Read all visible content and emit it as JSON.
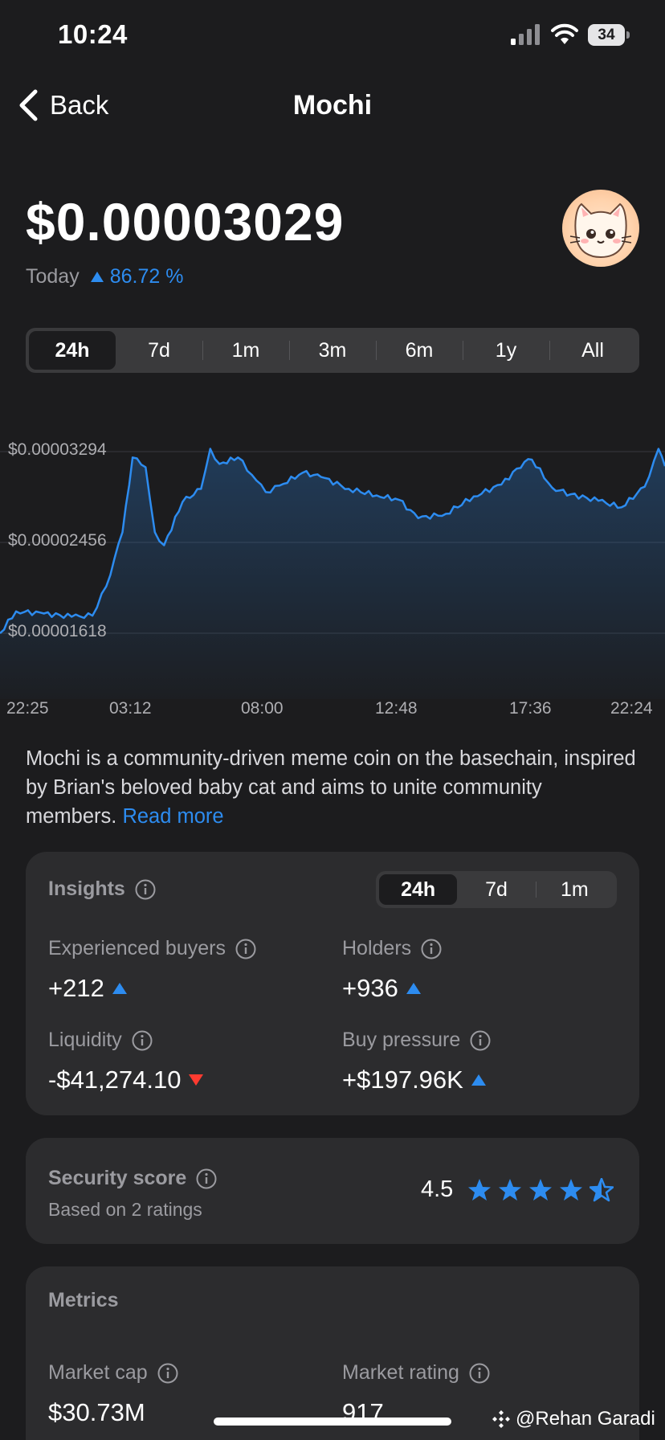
{
  "status": {
    "time": "10:24",
    "battery": "34"
  },
  "nav": {
    "back_label": "Back",
    "title": "Mochi"
  },
  "price": {
    "value": "$0.00003029",
    "period": "Today",
    "change": "86.72 %"
  },
  "ranges": [
    "24h",
    "7d",
    "1m",
    "3m",
    "6m",
    "1y",
    "All"
  ],
  "chart_data": {
    "type": "area",
    "color": "#2d8cf0",
    "y_ticks": [
      "$0.00003294",
      "$0.00002456",
      "$0.00001618"
    ],
    "x_ticks": [
      "22:25",
      "03:12",
      "08:00",
      "12:48",
      "17:36",
      "22:24"
    ],
    "ylim": [
      1.618e-05,
      3.294e-05
    ],
    "points": [
      [
        "22:25",
        1.618e-05
      ],
      [
        "23:00",
        1.82e-05
      ],
      [
        "00:00",
        1.8e-05
      ],
      [
        "01:00",
        1.77e-05
      ],
      [
        "01:45",
        1.78e-05
      ],
      [
        "02:15",
        2.05e-05
      ],
      [
        "02:50",
        2.55e-05
      ],
      [
        "03:12",
        3.24e-05
      ],
      [
        "03:40",
        3.15e-05
      ],
      [
        "04:00",
        2.55e-05
      ],
      [
        "04:20",
        2.43e-05
      ],
      [
        "05:00",
        2.83e-05
      ],
      [
        "05:40",
        2.95e-05
      ],
      [
        "06:00",
        3.32e-05
      ],
      [
        "06:20",
        3.18e-05
      ],
      [
        "07:00",
        3.24e-05
      ],
      [
        "07:30",
        3.08e-05
      ],
      [
        "08:00",
        2.92e-05
      ],
      [
        "08:30",
        2.98e-05
      ],
      [
        "09:20",
        3.1e-05
      ],
      [
        "10:00",
        3.06e-05
      ],
      [
        "11:00",
        2.95e-05
      ],
      [
        "12:00",
        2.89e-05
      ],
      [
        "12:48",
        2.85e-05
      ],
      [
        "13:30",
        2.68e-05
      ],
      [
        "14:30",
        2.72e-05
      ],
      [
        "15:30",
        2.88e-05
      ],
      [
        "16:30",
        2.99e-05
      ],
      [
        "17:20",
        3.2e-05
      ],
      [
        "17:36",
        3.22e-05
      ],
      [
        "18:20",
        2.96e-05
      ],
      [
        "19:00",
        2.9e-05
      ],
      [
        "20:00",
        2.84e-05
      ],
      [
        "20:50",
        2.78e-05
      ],
      [
        "21:40",
        2.97e-05
      ],
      [
        "22:10",
        3.32e-05
      ],
      [
        "22:24",
        3.16e-05
      ]
    ]
  },
  "description": {
    "text": "Mochi is a community-driven meme coin on the basechain, inspired by Brian's beloved baby cat and aims to unite community members.",
    "more": "Read more"
  },
  "insights": {
    "title": "Insights",
    "tabs": [
      "24h",
      "7d",
      "1m"
    ],
    "metrics": [
      {
        "label": "Experienced buyers",
        "value": "+212",
        "dir": "up"
      },
      {
        "label": "Holders",
        "value": "+936",
        "dir": "up"
      },
      {
        "label": "Liquidity",
        "value": "-$41,274.10",
        "dir": "down"
      },
      {
        "label": "Buy pressure",
        "value": "+$197.96K",
        "dir": "up"
      }
    ]
  },
  "security": {
    "title": "Security score",
    "subtitle": "Based on 2 ratings",
    "score": "4.5",
    "rating": 4.5
  },
  "metrics": {
    "title": "Metrics",
    "items": [
      {
        "label": "Market cap",
        "value": "$30.73M"
      },
      {
        "label": "Market rating",
        "value": "917"
      }
    ]
  },
  "watermark": "@Rehan Garadi",
  "colors": {
    "accent": "#2d8cf0",
    "down": "#ff3b30",
    "background": "#1c1c1e",
    "card": "#2c2c2e"
  }
}
